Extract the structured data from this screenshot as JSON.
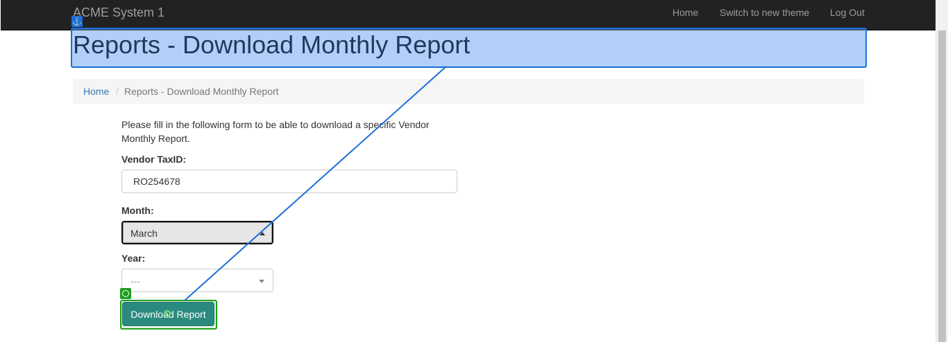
{
  "navbar": {
    "brand": "ACME System 1",
    "links": [
      "Home",
      "Switch to new theme",
      "Log Out"
    ]
  },
  "page": {
    "title": "Reports - Download Monthly Report"
  },
  "breadcrumb": {
    "home": "Home",
    "separator": "/",
    "current": "Reports - Download Monthly Report"
  },
  "form": {
    "intro": "Please fill in the following form to be able to download a specific Vendor Monthly Report.",
    "taxid_label": "Vendor TaxID:",
    "taxid_value": "RO254678",
    "month_label": "Month:",
    "month_value": "March",
    "year_label": "Year:",
    "year_value": "---",
    "submit_label": "Download Report"
  },
  "overlay": {
    "anchor_icon": "anchor-icon",
    "target_icon": "target-icon",
    "highlight_color": "#1a6fd8",
    "target_color": "#1e9e1e"
  }
}
